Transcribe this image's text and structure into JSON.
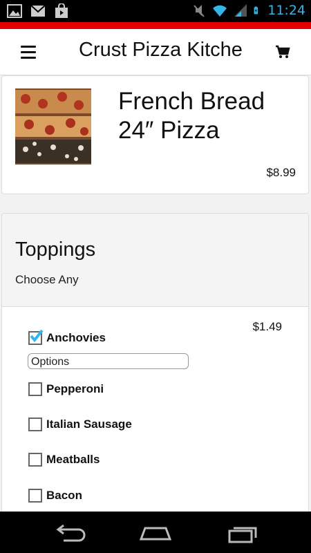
{
  "status_bar": {
    "time": "11:24",
    "left_icons": [
      "gallery-icon",
      "gmail-icon",
      "bag-icon"
    ],
    "right_icons": [
      "mute-icon",
      "wifi-icon",
      "signal-icon",
      "battery-icon"
    ]
  },
  "header": {
    "title": "Crust Pizza Kitche",
    "accent_color": "#e00000"
  },
  "product": {
    "name": "French Bread 24″ Pizza",
    "price": "$8.99"
  },
  "toppings": {
    "title": "Toppings",
    "subtitle": "Choose Any",
    "options_placeholder": "Options",
    "items": [
      {
        "label": "Anchovies",
        "checked": true,
        "price": "$1.49"
      },
      {
        "label": "Pepperoni",
        "checked": false
      },
      {
        "label": "Italian Sausage",
        "checked": false
      },
      {
        "label": "Meatballs",
        "checked": false
      },
      {
        "label": "Bacon",
        "checked": false
      }
    ]
  },
  "nav_bar": {
    "buttons": [
      "back-icon",
      "home-icon",
      "recent-apps-icon"
    ]
  }
}
